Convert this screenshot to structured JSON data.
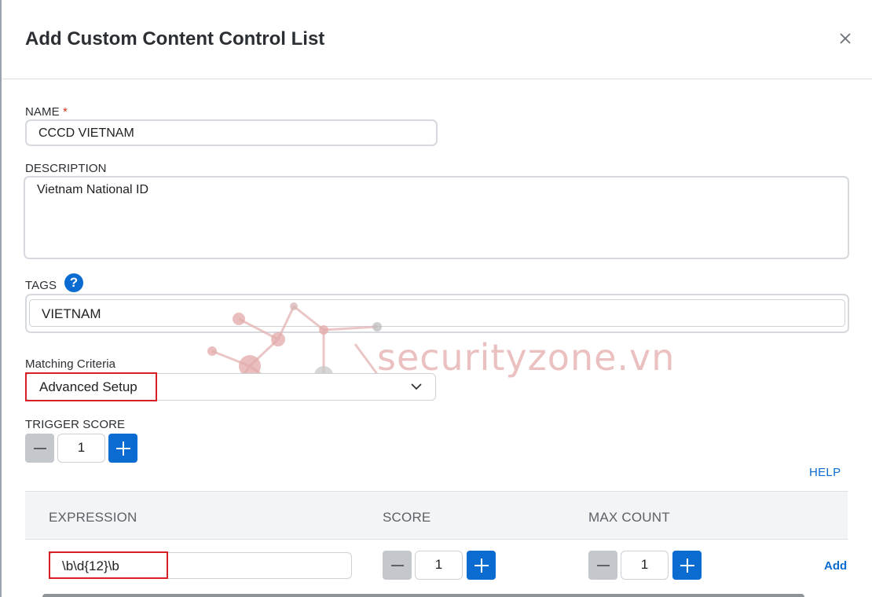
{
  "dialog": {
    "title": "Add Custom Content Control List"
  },
  "form": {
    "name_label": "NAME",
    "name_required": "*",
    "name_value": "CCCD VIETNAM",
    "description_label": "DESCRIPTION",
    "description_value": "Vietnam National ID",
    "tags_label": "TAGS",
    "tags_help_icon": "?",
    "tags_value": "VIETNAM",
    "matching_label": "Matching Criteria",
    "matching_value": "Advanced Setup",
    "trigger_label": "TRIGGER SCORE",
    "trigger_value": "1"
  },
  "help_link": "HELP",
  "table": {
    "columns": [
      "EXPRESSION",
      "SCORE",
      "MAX COUNT"
    ],
    "row": {
      "expression": "\\b\\d{12}\\b",
      "score": "1",
      "max_count": "1",
      "add_label": "Add"
    }
  },
  "watermark": {
    "text": "securityzone.vn"
  },
  "colors": {
    "accent": "#0a6bd1",
    "highlight_border": "#d91f26",
    "required": "#d0331c"
  },
  "icons": {
    "close": "close-icon",
    "help": "question-circle-icon",
    "dropdown": "chevron-down-icon",
    "minus": "minus-icon",
    "plus": "plus-icon"
  }
}
